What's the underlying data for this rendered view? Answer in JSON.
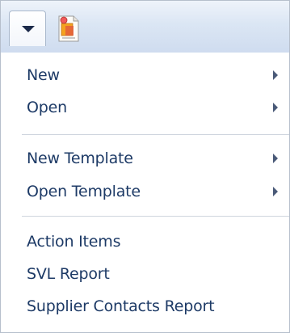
{
  "menu": {
    "group1": [
      {
        "label": "New",
        "has_submenu": true
      },
      {
        "label": "Open",
        "has_submenu": true
      }
    ],
    "group2": [
      {
        "label": "New Template",
        "has_submenu": true
      },
      {
        "label": "Open Template",
        "has_submenu": true
      }
    ],
    "group3": [
      {
        "label": "Action Items",
        "has_submenu": false
      },
      {
        "label": "SVL Report",
        "has_submenu": false
      },
      {
        "label": "Supplier Contacts Report",
        "has_submenu": false
      }
    ]
  },
  "icons": {
    "dropdown": "chevron-down-icon",
    "document": "document-icon",
    "submenu": "submenu-arrow-icon"
  },
  "colors": {
    "menu_text": "#1d3a66",
    "toolbar_top": "#eef3fa",
    "toolbar_bottom": "#cfdcef",
    "separator": "#cfd5de"
  }
}
